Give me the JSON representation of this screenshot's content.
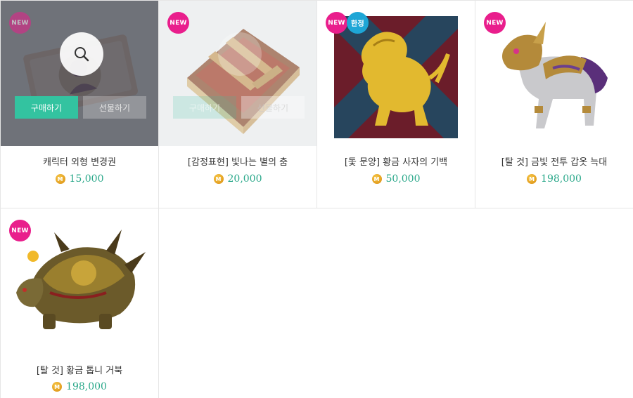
{
  "badges": {
    "new": "NEW",
    "limited": "한정"
  },
  "currency_icon": "M",
  "buttons": {
    "buy": "구매하기",
    "gift": "선물하기"
  },
  "colors": {
    "accent": "#33c3a0",
    "badge_new": "#e91e8c",
    "badge_limited": "#1ea6d6",
    "price": "#2aa88a"
  },
  "products": [
    {
      "name": "캐릭터 외형 변경권",
      "price": "15,000",
      "icon": "ticket-icon",
      "badges": [
        "NEW"
      ],
      "state": "hovered"
    },
    {
      "name": "[감정표현] 빛나는 별의 춤",
      "price": "20,000",
      "icon": "book-icon",
      "badges": [
        "NEW"
      ],
      "state": "hover-fading"
    },
    {
      "name": "[돛 문양] 황금 사자의 기백",
      "price": "50,000",
      "icon": "lion-banner-icon",
      "badges": [
        "NEW",
        "한정"
      ],
      "state": "normal"
    },
    {
      "name": "[탈 것] 금빛 전투 갑옷 늑대",
      "price": "198,000",
      "icon": "armored-wolf-icon",
      "badges": [
        "NEW"
      ],
      "state": "normal"
    },
    {
      "name": "[탈 것] 황금 톱니 거북",
      "price": "198,000",
      "icon": "golden-turtle-icon",
      "badges": [
        "NEW"
      ],
      "state": "normal"
    }
  ]
}
